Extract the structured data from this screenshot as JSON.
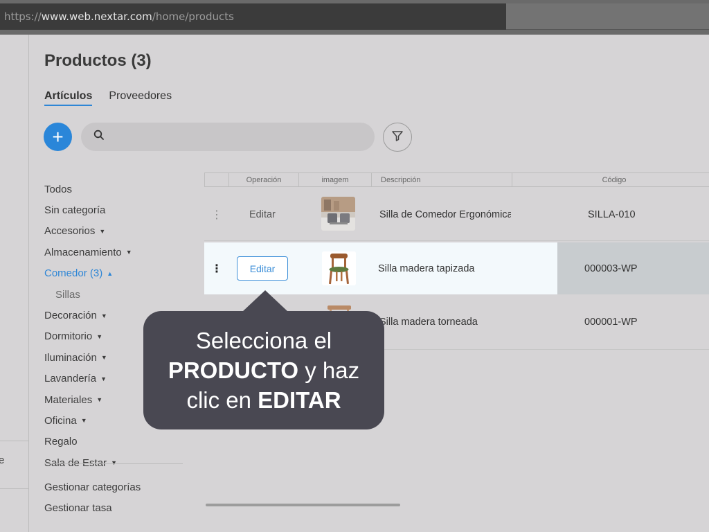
{
  "browser": {
    "url_scheme": "https://",
    "url_host": "www.web.nextar.com",
    "url_path": "/home/products"
  },
  "left_edge": {
    "fragment": "e"
  },
  "page": {
    "title": "Productos (3)"
  },
  "tabs": [
    {
      "label": "Artículos",
      "active": true
    },
    {
      "label": "Proveedores",
      "active": false
    }
  ],
  "toolbar": {
    "add_label": "+",
    "search_placeholder": "",
    "search_icon": "search-icon",
    "filter_icon": "filter-icon"
  },
  "categories": [
    {
      "label": "Todos"
    },
    {
      "label": "Sin categoría"
    },
    {
      "label": "Accesorios",
      "caret": "▼"
    },
    {
      "label": "Almacenamiento",
      "caret": "▼"
    },
    {
      "label": "Comedor (3)",
      "caret": "▲",
      "active": true
    },
    {
      "label": "Sillas",
      "sub": true
    },
    {
      "label": "Decoración",
      "caret": "▼"
    },
    {
      "label": "Dormitorio",
      "caret": "▼"
    },
    {
      "label": "Iluminación",
      "caret": "▼"
    },
    {
      "label": "Lavandería",
      "caret": "▼"
    },
    {
      "label": "Materiales",
      "caret": "▼"
    },
    {
      "label": "Oficina",
      "caret": "▼"
    },
    {
      "label": "Regalo"
    },
    {
      "label": "Sala de Estar",
      "caret": "▼"
    }
  ],
  "manage": {
    "categories": "Gestionar categorías",
    "rates": "Gestionar tasa"
  },
  "table": {
    "headers": {
      "operation": "Operación",
      "image": "imagem",
      "description": "Descripción",
      "code": "Código"
    },
    "rows": [
      {
        "kebab": "⋮",
        "operation": "Editar",
        "description": "Silla de Comedor Ergonómica",
        "code": "SILLA-010"
      },
      {
        "kebab": "⋮",
        "operation": "Editar",
        "description": "Silla madera tapizada",
        "code": "000003-WP"
      },
      {
        "kebab": "",
        "operation": "",
        "description": "Silla madera torneada",
        "code": "000001-WP"
      }
    ]
  },
  "tooltip": {
    "line1": "Selecciona el",
    "line2_bold": "PRODUCTO",
    "line2_rest": " y haz",
    "line3_pre": "clic en ",
    "line3_bold": "EDITAR"
  },
  "colors": {
    "accent": "#2a86d9",
    "tooltip_bg": "#494852",
    "page_bg": "#d6d4d6"
  }
}
